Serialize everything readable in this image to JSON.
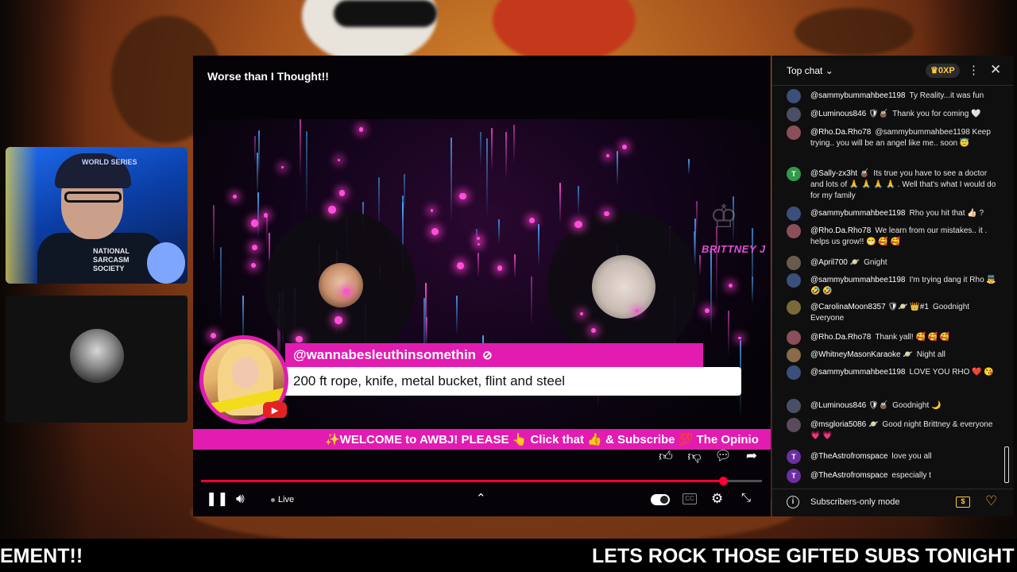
{
  "player": {
    "title": "Worse than I Thought!!",
    "watermark": "BRITTNEY J",
    "featured_comment": {
      "author": "@wannabesleuthinsomethin",
      "text": "200 ft rope, knife, metal bucket, flint and steel"
    },
    "ticker": "✨WELCOME to AWBJ! PLEASE 👆 Click that 👍 & Subscribe 💯 The Opinio",
    "live_label": "Live",
    "cc_label": "CC",
    "progress_fraction": 0.93
  },
  "host_cam": {
    "cap_text": "WORLD SERIES",
    "shirt_text": "NATIONAL SARCASM SOCIETY"
  },
  "chat": {
    "title": "Top chat",
    "xp": "0XP",
    "footer_label": "Subscribers-only mode",
    "messages": [
      {
        "author": "@sammybummahbee1198",
        "text": "Ty Reality...it was fun",
        "avatar": "",
        "color": "#3a4f7a"
      },
      {
        "author": "@Luminous846 🛡🧉",
        "text": "Thank you for coming 🤍",
        "avatar": "",
        "color": "#4b4f66"
      },
      {
        "author": "@Rho.Da.Rho78",
        "text": "@sammybummahbee1198 Keep trying.. you will be an angel like me.. soon 😇",
        "avatar": "",
        "color": "#8a4f5a"
      },
      {
        "author": "@Sally-zx3ht 🧉",
        "text": "Its true you have to see a doctor and lots of 🙏 🙏 🙏 🙏 . Well that's what I would do for my family",
        "avatar": "T",
        "color": "#2f9a4a"
      },
      {
        "author": "@sammybummahbee1198",
        "text": "Rho you hit that 👍🏻 ?",
        "avatar": "",
        "color": "#3a4f7a"
      },
      {
        "author": "@Rho.Da.Rho78",
        "text": "We learn from our mistakes.. it . helps us grow!! 😁 🥰 🥰",
        "avatar": "",
        "color": "#8a4f5a"
      },
      {
        "author": "@April700 🪐",
        "text": "Gnight",
        "avatar": "",
        "color": "#6a5a4a"
      },
      {
        "author": "@sammybummahbee1198",
        "text": "I'm trying dang it Rho 👼 🤣 🤣",
        "avatar": "",
        "color": "#3a4f7a"
      },
      {
        "author": "@CarolinaMoon8357 🛡🪐 👑#1",
        "text": "Goodnight Everyone",
        "avatar": "",
        "color": "#7a6a3a"
      },
      {
        "author": "@Rho.Da.Rho78",
        "text": "Thank yall! 🥰 🥰 🥰",
        "avatar": "",
        "color": "#8a4f5a"
      },
      {
        "author": "@WhitneyMasonKaraoke 🪐",
        "text": "Night all",
        "avatar": "",
        "color": "#8a6a4a"
      },
      {
        "author": "@sammybummahbee1198",
        "text": "LOVE YOU RHO ❤️ 😘",
        "avatar": "",
        "color": "#3a4f7a"
      },
      {
        "author": "@Luminous846 🛡🧉",
        "text": "Goodnight 🌙",
        "avatar": "",
        "color": "#4b4f66"
      },
      {
        "author": "@msgloria5086 🪐",
        "text": "Good night Brittney & everyone 💗 💗",
        "avatar": "",
        "color": "#5a4a5a"
      },
      {
        "author": "@TheAstrofromspace",
        "text": "love you all",
        "avatar": "T",
        "color": "#6a2fa0"
      },
      {
        "author": "@TheAstrofromspace",
        "text": "especially t",
        "avatar": "T",
        "color": "#6a2fa0"
      }
    ]
  },
  "bottom_ticker": {
    "left": "EMENT!!",
    "right": "LETS ROCK THOSE GIFTED SUBS TONIGHT"
  },
  "icons": {
    "pause": "pause-icon",
    "volume": "volume-icon",
    "settings": "gear-icon",
    "fullscreen": "exit-fullscreen-icon"
  }
}
